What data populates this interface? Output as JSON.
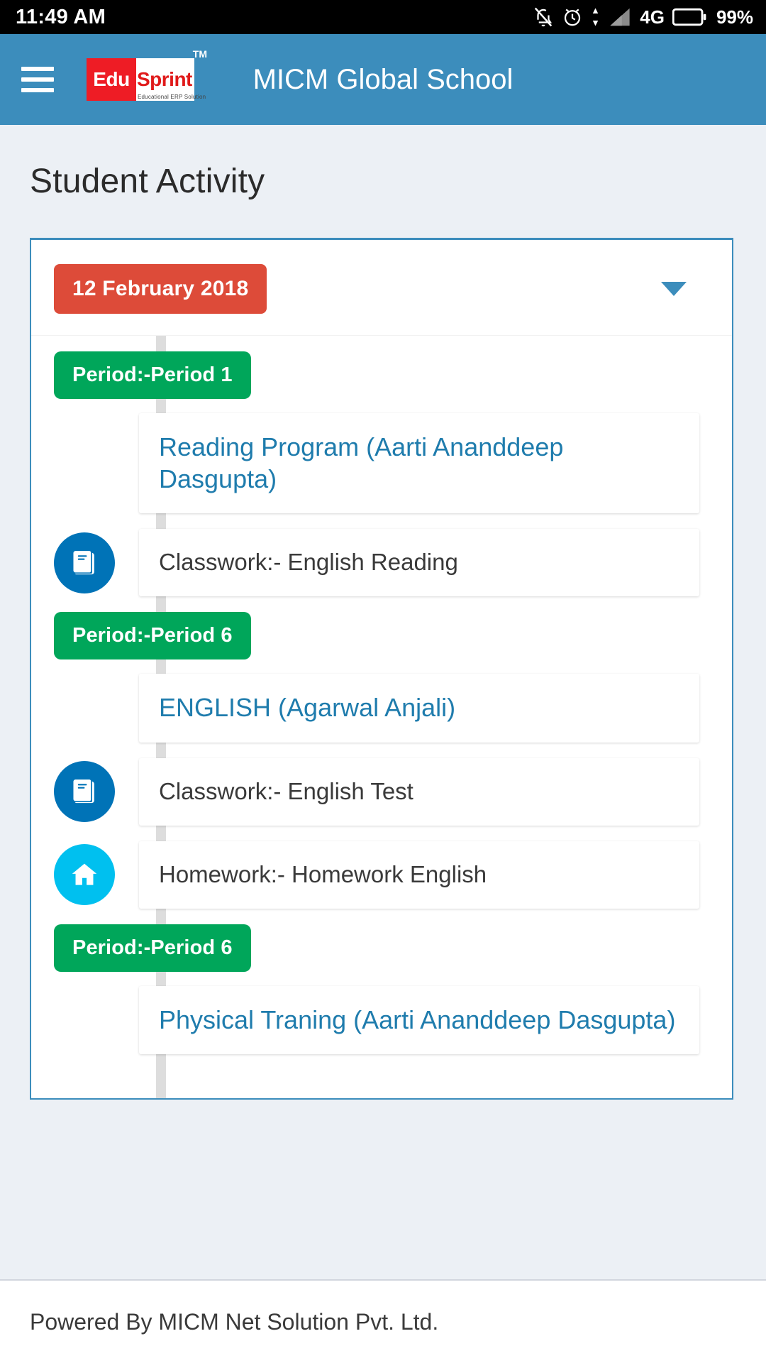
{
  "status_bar": {
    "time": "11:49 AM",
    "network": "4G",
    "battery": "99%",
    "icons": [
      "bell-muted-icon",
      "alarm-clock-icon",
      "data-transfer-icon",
      "signal-icon",
      "battery-icon"
    ]
  },
  "app_bar": {
    "menu_icon": "hamburger-menu-icon",
    "logo": {
      "part1": "Edu",
      "part2": "Sprint",
      "trademark": "TM",
      "tagline": "Educational ERP Solution"
    },
    "title": "MICM Global School"
  },
  "page": {
    "title": "Student Activity"
  },
  "card": {
    "date_badge": "12 February 2018",
    "expand_icon": "chevron-down-icon"
  },
  "timeline": [
    {
      "period_label": "Period:-Period 1",
      "entries": [
        {
          "icon": "none",
          "type": "heading",
          "text": "Reading Program (Aarti Ananddeep Dasgupta)"
        },
        {
          "icon": "book-icon",
          "type": "text",
          "text": "Classwork:- English Reading"
        }
      ]
    },
    {
      "period_label": "Period:-Period 6",
      "entries": [
        {
          "icon": "none",
          "type": "heading",
          "text": "ENGLISH (Agarwal Anjali)"
        },
        {
          "icon": "book-icon",
          "type": "text",
          "text": "Classwork:- English Test"
        },
        {
          "icon": "home-icon",
          "type": "text",
          "text": "Homework:- Homework English"
        }
      ]
    },
    {
      "period_label": "Period:-Period 6",
      "entries": [
        {
          "icon": "none",
          "type": "heading",
          "text": "Physical Traning (Aarti Ananddeep Dasgupta)"
        }
      ]
    }
  ],
  "footer": {
    "text": "Powered By MICM Net Solution Pvt. Ltd."
  },
  "colors": {
    "appbar": "#3c8dbc",
    "page_bg": "#ecf0f5",
    "date_badge": "#dd4b39",
    "period_badge": "#00a65a",
    "link": "#1f7cad",
    "book_icon_bg": "#0073b7",
    "home_icon_bg": "#00c0ef"
  }
}
